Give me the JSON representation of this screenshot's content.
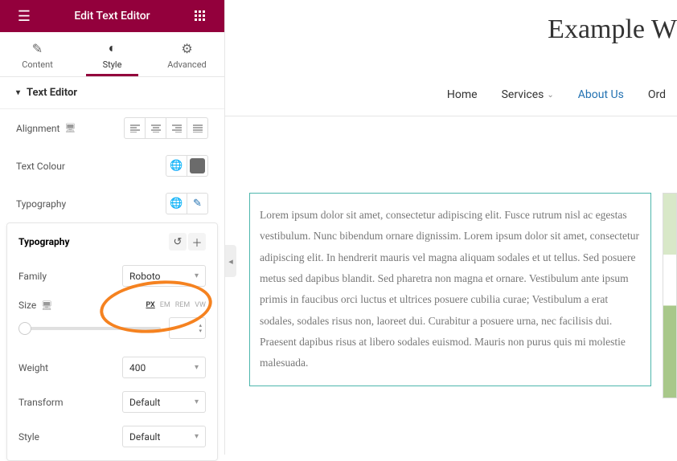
{
  "panel": {
    "title": "Edit Text Editor",
    "tabs": {
      "content": "Content",
      "style": "Style",
      "advanced": "Advanced",
      "active": "style"
    },
    "section_title": "Text Editor",
    "controls": {
      "alignment_label": "Alignment",
      "text_color_label": "Text Colour",
      "text_color_value": "#6b6b6b",
      "typography_label": "Typography"
    }
  },
  "popover": {
    "title": "Typography",
    "family_label": "Family",
    "family_value": "Roboto",
    "size_label": "Size",
    "units": [
      "PX",
      "EM",
      "REM",
      "VW"
    ],
    "active_unit": "PX",
    "weight_label": "Weight",
    "weight_value": "400",
    "transform_label": "Transform",
    "transform_value": "Default",
    "style_label": "Style",
    "style_value": "Default"
  },
  "preview": {
    "site_title": "Example W",
    "nav": {
      "home": "Home",
      "services": "Services",
      "about": "About Us",
      "order": "Ord"
    },
    "body_text": "Lorem ipsum dolor sit amet, consectetur adipiscing elit. Fusce rutrum nisl ac egestas vestibulum. Nunc bibendum ornare dignissim. Lorem ipsum dolor sit amet, consectetur adipiscing elit. In hendrerit mauris vel magna aliquam sodales et ut tellus. Sed posuere metus sed dapibus blandit. Sed pharetra non magna et ornare. Vestibulum ante ipsum primis in faucibus orci luctus et ultrices posuere cubilia curae; Vestibulum a erat sodales, sodales risus non, laoreet dui. Curabitur a posuere urna, nec facilisis dui. Praesent dapibus risus at libero sodales euismod. Mauris non purus quis mi molestie malesuada."
  }
}
